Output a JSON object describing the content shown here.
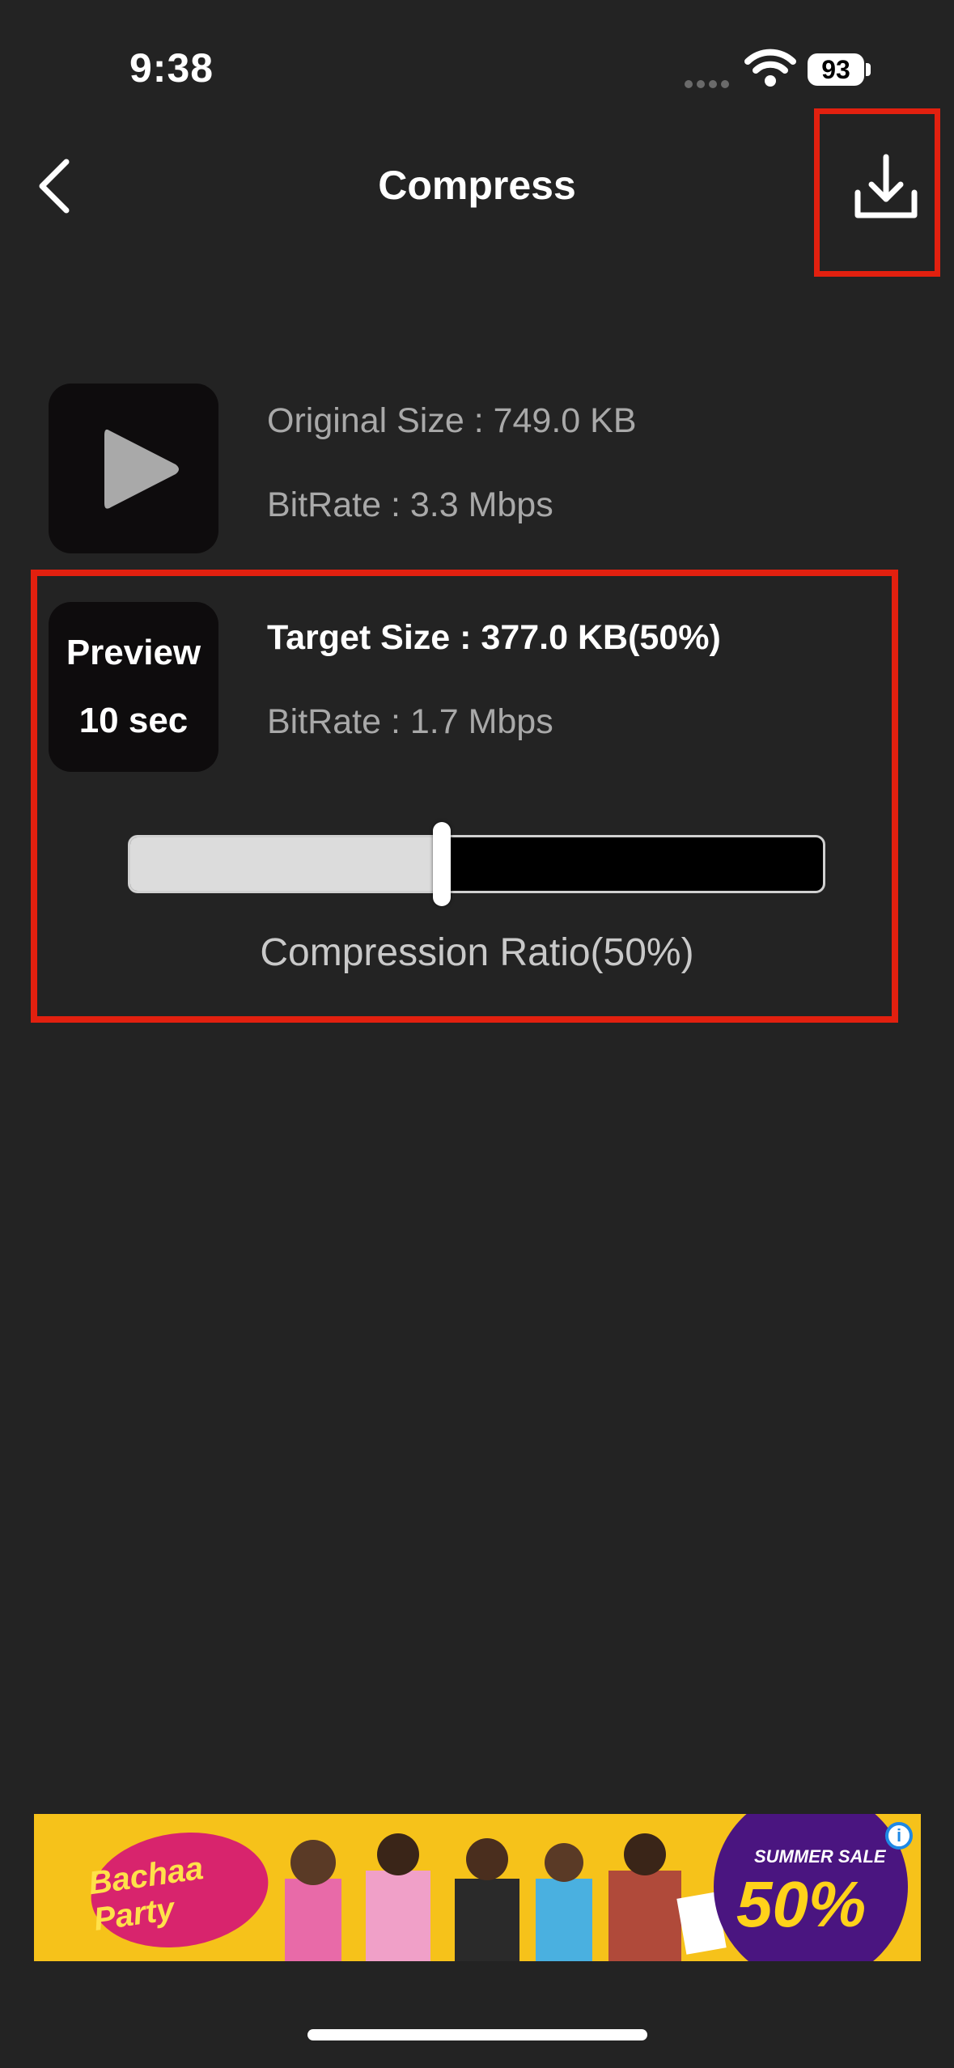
{
  "status_bar": {
    "time": "9:38",
    "battery": "93"
  },
  "nav": {
    "title": "Compress",
    "back_icon": "chevron-left-icon",
    "download_icon": "download-icon"
  },
  "original": {
    "size": "Original Size : 749.0 KB",
    "bitrate": "BitRate : 3.3 Mbps"
  },
  "target": {
    "preview_label": "Preview",
    "preview_duration": "10 sec",
    "size": "Target Size : 377.0 KB(50%)",
    "bitrate": "BitRate : 1.7 Mbps"
  },
  "slider": {
    "value_percent": 45,
    "label": "Compression Ratio(50%)"
  },
  "ad": {
    "logo_text": "Bachaa Party",
    "sale_headline": "SUMMER SALE",
    "sale_value": "50%"
  },
  "colors": {
    "background": "#232323",
    "highlight": "#e2200f",
    "text_secondary": "#a9a9a9"
  }
}
